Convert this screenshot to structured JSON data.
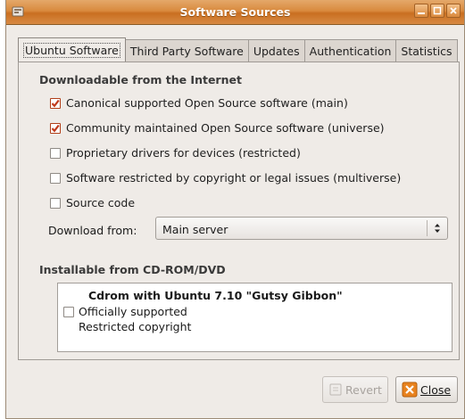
{
  "window": {
    "title": "Software Sources"
  },
  "tabs": [
    {
      "label": "Ubuntu Software",
      "active": true
    },
    {
      "label": "Third Party Software",
      "active": false
    },
    {
      "label": "Updates",
      "active": false
    },
    {
      "label": "Authentication",
      "active": false
    },
    {
      "label": "Statistics",
      "active": false
    }
  ],
  "internet": {
    "heading": "Downloadable from the Internet",
    "options": [
      {
        "label": "Canonical supported Open Source software (main)",
        "checked": true
      },
      {
        "label": "Community maintained Open Source software (universe)",
        "checked": true
      },
      {
        "label": "Proprietary drivers for devices (restricted)",
        "checked": false
      },
      {
        "label": "Software restricted by copyright or legal issues (multiverse)",
        "checked": false
      },
      {
        "label": "Source code",
        "checked": false
      }
    ],
    "download_from_label": "Download from:",
    "download_from_value": "Main server"
  },
  "cdrom": {
    "heading": "Installable from CD-ROM/DVD",
    "item_title": "Cdrom with Ubuntu 7.10 \"Gutsy Gibbon\"",
    "item_line1": "Officially supported",
    "item_line2": "Restricted copyright",
    "checked": false
  },
  "buttons": {
    "revert": "Revert",
    "close": "Close"
  },
  "colors": {
    "titlebar": "#d98a3e",
    "check_accent": "#c0391b",
    "close_icon": "#e8821e"
  }
}
